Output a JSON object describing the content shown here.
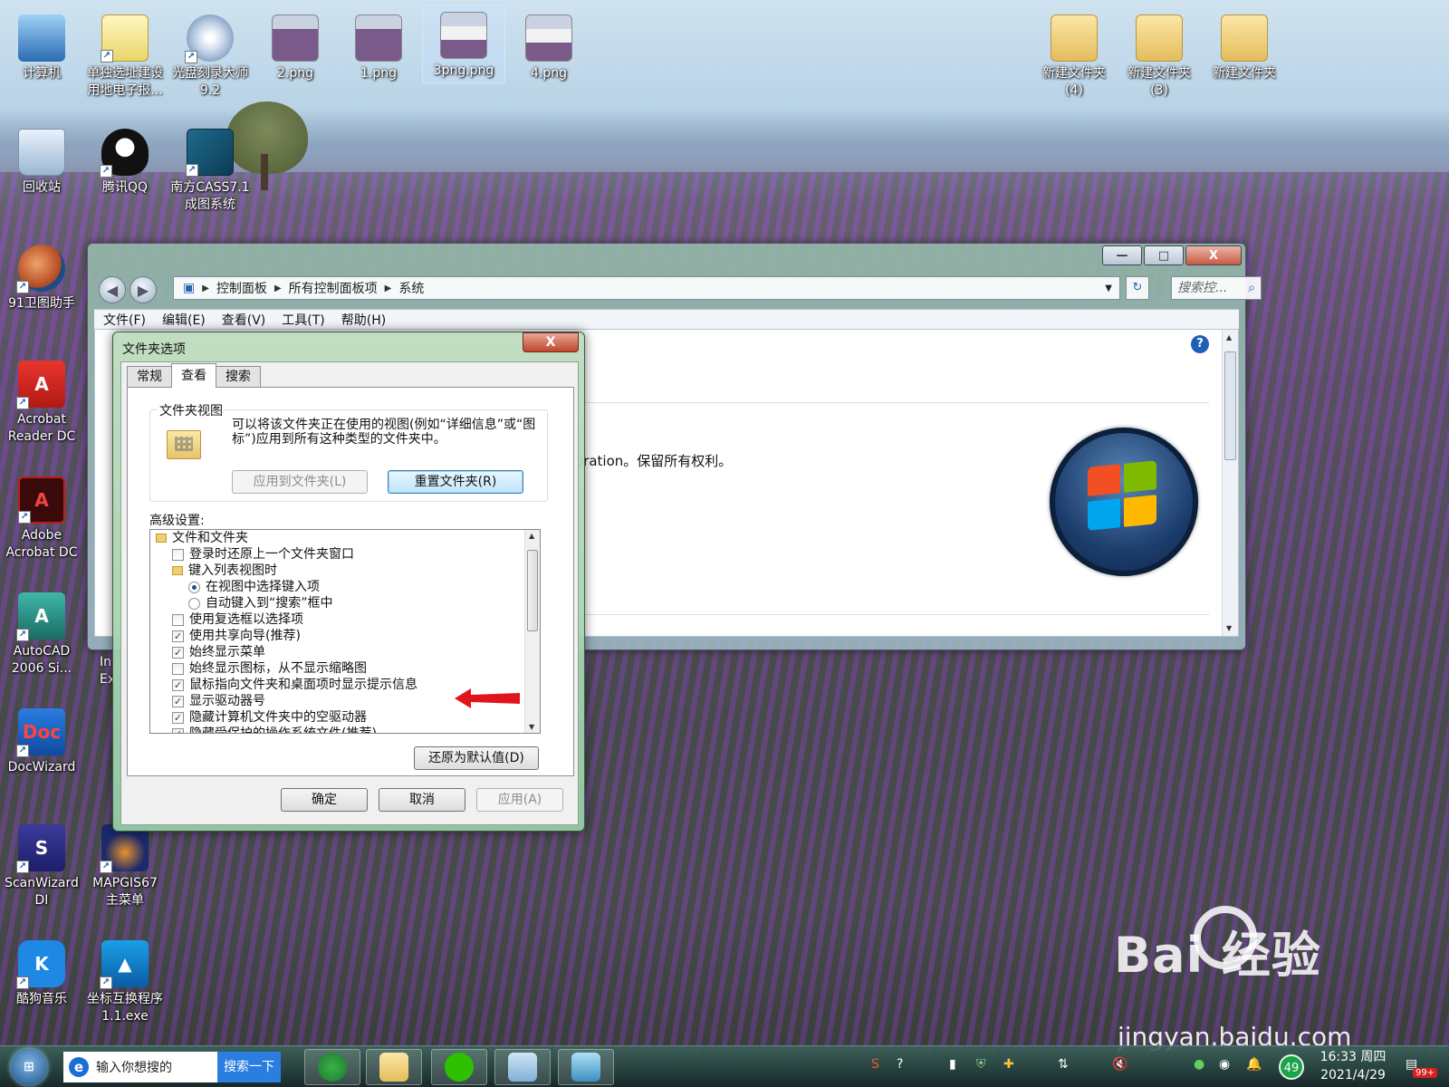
{
  "desktop": {
    "icons": [
      {
        "label": "计算机"
      },
      {
        "label": "单独选址建设\n用地电子报..."
      },
      {
        "label": "光盘刻录大师\n9.2"
      },
      {
        "label": "2.png"
      },
      {
        "label": "1.png"
      },
      {
        "label": "3png.png"
      },
      {
        "label": "4.png"
      },
      {
        "label": "新建文件夹\n(4)"
      },
      {
        "label": "新建文件夹\n(3)"
      },
      {
        "label": "新建文件夹"
      },
      {
        "label": "回收站"
      },
      {
        "label": "腾讯QQ"
      },
      {
        "label": "南方CASS7.1\n成图系统"
      },
      {
        "label": "91卫图助手"
      },
      {
        "label": "Acrobat\nReader DC"
      },
      {
        "label": "Adobe\nAcrobat DC"
      },
      {
        "label": "AutoCAD\n2006 Si..."
      },
      {
        "label": "DocWizard"
      },
      {
        "label": "ScanWizard\nDI"
      },
      {
        "label": "MAPGIS67\n主菜单"
      },
      {
        "label": "酷狗音乐"
      },
      {
        "label": "坐标互换程序\n1.1.exe"
      }
    ],
    "partial_labels": [
      "In",
      "Ex"
    ]
  },
  "explorer": {
    "controls": {
      "minimize": "—",
      "maximize": "□",
      "close": "X"
    },
    "breadcrumb": [
      "控制面板",
      "所有控制面板项",
      "系统"
    ],
    "search_placeholder": "搜索控...",
    "menu": [
      "文件(F)",
      "编辑(E)",
      "查看(V)",
      "工具(T)",
      "帮助(H)"
    ],
    "copyright_text": "oration。保留所有权利。",
    "help_glyph": "?"
  },
  "dialog": {
    "title": "文件夹选项",
    "close_glyph": "X",
    "tabs": [
      "常规",
      "查看",
      "搜索"
    ],
    "active_tab": 1,
    "folder_view": {
      "title": "文件夹视图",
      "description": "可以将该文件夹正在使用的视图(例如“详细信息”或“图标”)应用到所有这种类型的文件夹中。",
      "apply_button": "应用到文件夹(L)",
      "reset_button": "重置文件夹(R)"
    },
    "advanced_label": "高级设置:",
    "advanced_items": [
      {
        "type": "folder",
        "label": "文件和文件夹",
        "indent": 0
      },
      {
        "type": "checkbox",
        "label": "登录时还原上一个文件夹窗口",
        "checked": false,
        "indent": 1
      },
      {
        "type": "folder",
        "label": "键入列表视图时",
        "indent": 1
      },
      {
        "type": "radio",
        "label": "在视图中选择键入项",
        "checked": true,
        "indent": 2
      },
      {
        "type": "radio",
        "label": "自动键入到“搜索”框中",
        "checked": false,
        "indent": 2
      },
      {
        "type": "checkbox",
        "label": "使用复选框以选择项",
        "checked": false,
        "indent": 1
      },
      {
        "type": "checkbox",
        "label": "使用共享向导(推荐)",
        "checked": true,
        "indent": 1
      },
      {
        "type": "checkbox",
        "label": "始终显示菜单",
        "checked": true,
        "indent": 1
      },
      {
        "type": "checkbox",
        "label": "始终显示图标，从不显示缩略图",
        "checked": false,
        "indent": 1
      },
      {
        "type": "checkbox",
        "label": "鼠标指向文件夹和桌面项时显示提示信息",
        "checked": true,
        "indent": 1
      },
      {
        "type": "checkbox",
        "label": "显示驱动器号",
        "checked": true,
        "indent": 1
      },
      {
        "type": "checkbox",
        "label": "隐藏计算机文件夹中的空驱动器",
        "checked": true,
        "indent": 1
      },
      {
        "type": "checkbox",
        "label": "隐藏受保护的操作系统文件(推荐)",
        "checked": true,
        "indent": 1
      }
    ],
    "restore_button": "还原为默认值(D)",
    "ok_button": "确定",
    "cancel_button": "取消",
    "apply_button": "应用(A)"
  },
  "taskbar": {
    "search_placeholder": "输入你想搜的",
    "search_button": "搜索一下",
    "time": "16:33 周四",
    "date": "2021/4/29",
    "badge_count": "49",
    "notif_count": "99+"
  },
  "watermark": {
    "brand": "Bai  经验",
    "url": "jingyan.baidu.com"
  },
  "colors": {
    "accent_blue": "#2a7de1",
    "arrow_red": "#e0151b",
    "dialog_green": "#9fd3a9"
  }
}
